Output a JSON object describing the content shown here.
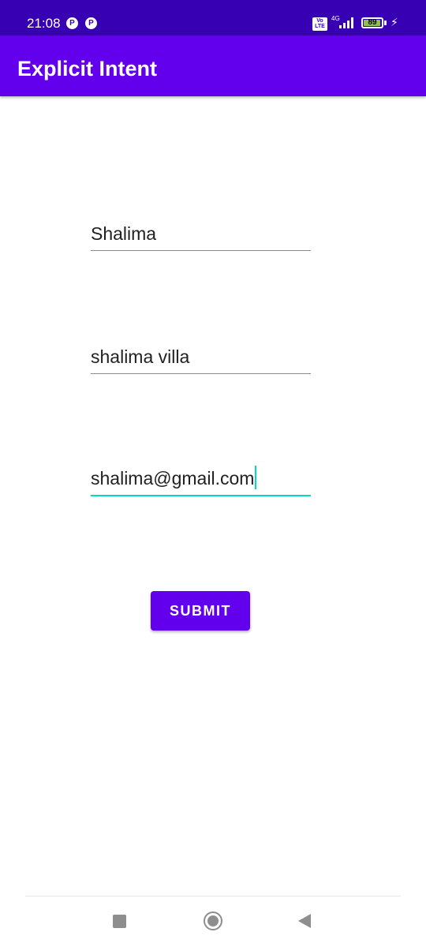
{
  "status_bar": {
    "time": "21:08",
    "notification_icons": [
      "notification-icon",
      "notification-icon"
    ],
    "volte_label": "Vo LTE",
    "network_label": "4G",
    "battery_level": "89",
    "charging": true
  },
  "app_bar": {
    "title": "Explicit Intent",
    "color": "#6200ee"
  },
  "form": {
    "name_value": "Shalima",
    "address_value": "shalima villa",
    "email_value": "shalima@gmail.com",
    "focused_field": "email"
  },
  "submit": {
    "label": "SUBMIT"
  },
  "colors": {
    "primary": "#6200ee",
    "primary_dark": "#3700b3",
    "accent": "#03dac5"
  },
  "nav_bar": {
    "buttons": [
      "recent-apps",
      "home",
      "back"
    ]
  }
}
